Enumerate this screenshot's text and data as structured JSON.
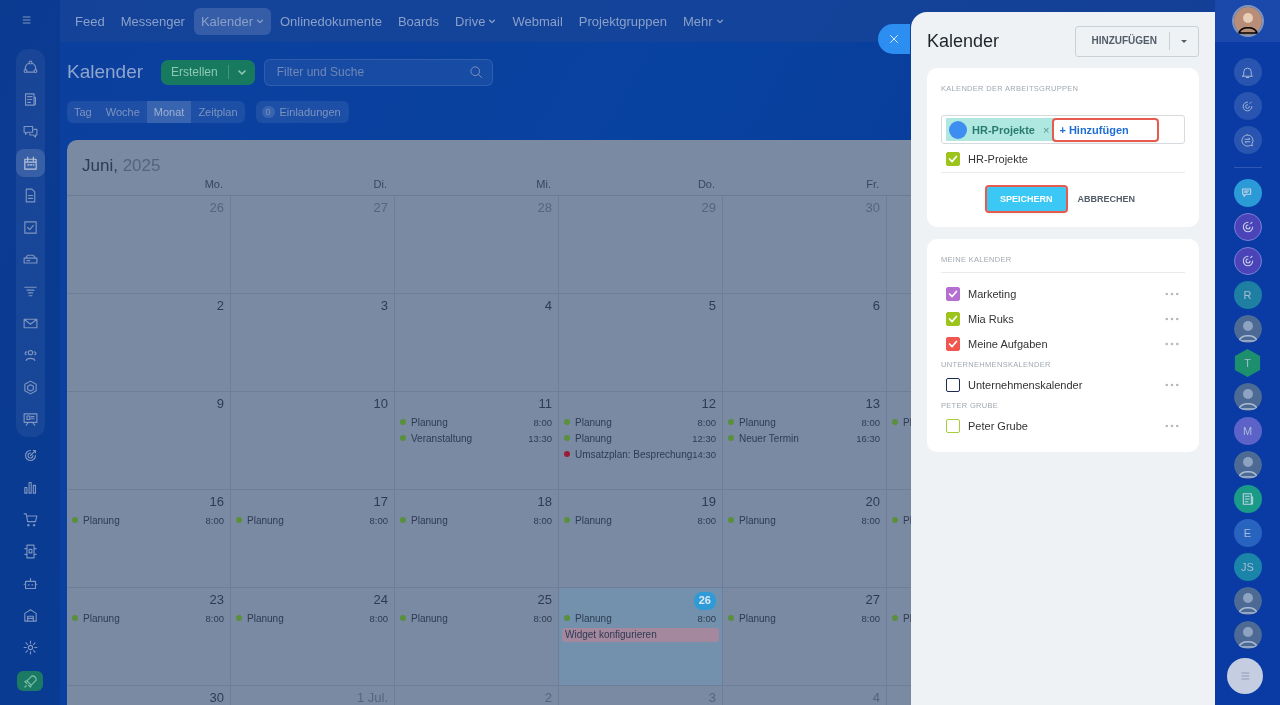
{
  "topnav": [
    {
      "label": "Feed",
      "selected": false,
      "dropdown": false
    },
    {
      "label": "Messenger",
      "selected": false,
      "dropdown": false
    },
    {
      "label": "Kalender",
      "selected": true,
      "dropdown": true
    },
    {
      "label": "Onlinedokumente",
      "selected": false,
      "dropdown": false
    },
    {
      "label": "Boards",
      "selected": false,
      "dropdown": false
    },
    {
      "label": "Drive",
      "selected": false,
      "dropdown": true
    },
    {
      "label": "Webmail",
      "selected": false,
      "dropdown": false
    },
    {
      "label": "Projektgruppen",
      "selected": false,
      "dropdown": false
    },
    {
      "label": "Mehr",
      "selected": false,
      "dropdown": true
    }
  ],
  "left_sidebar": {
    "group": [
      {
        "kind": "nodes",
        "selected": false
      },
      {
        "kind": "newspaper",
        "selected": false
      },
      {
        "kind": "chat-bubbles",
        "selected": false
      },
      {
        "kind": "calendar",
        "selected": true
      },
      {
        "kind": "document",
        "selected": false
      },
      {
        "kind": "checkbox",
        "selected": false
      },
      {
        "kind": "drive",
        "selected": false
      },
      {
        "kind": "funnel",
        "selected": false
      },
      {
        "kind": "envelope",
        "selected": false
      },
      {
        "kind": "people",
        "selected": false
      },
      {
        "kind": "hexagon",
        "selected": false
      },
      {
        "kind": "presentation",
        "selected": false
      }
    ],
    "items": [
      {
        "kind": "target",
        "selected": false
      },
      {
        "kind": "bar-chart",
        "selected": false
      },
      {
        "kind": "cart",
        "selected": false
      },
      {
        "kind": "device",
        "selected": false
      },
      {
        "kind": "robot",
        "selected": false
      },
      {
        "kind": "warehouse",
        "selected": false
      },
      {
        "kind": "gear",
        "selected": false
      },
      {
        "kind": "rocket"
      }
    ]
  },
  "page": {
    "title": "Kalender",
    "create_button": "Erstellen",
    "search": {
      "placeholder": "Filter und Suche"
    },
    "view_tabs": [
      {
        "label": "Tag",
        "selected": false
      },
      {
        "label": "Woche",
        "selected": false
      },
      {
        "label": "Monat",
        "selected": true
      },
      {
        "label": "Zeitplan",
        "selected": false
      }
    ],
    "invitations": {
      "count": "0",
      "label": "Einladungen"
    }
  },
  "calendar": {
    "month": "Juni,",
    "year": "2025",
    "weekdays": [
      "Mo.",
      "Di.",
      "Mi.",
      "Do.",
      "Fr."
    ],
    "weeks": [
      [
        {
          "date": "26",
          "muted": true
        },
        {
          "date": "27",
          "muted": true
        },
        {
          "date": "28",
          "muted": true
        },
        {
          "date": "29",
          "muted": true
        },
        {
          "date": "30",
          "muted": true
        }
      ],
      [
        {
          "date": "2",
          "muted": false
        },
        {
          "date": "3",
          "muted": false
        },
        {
          "date": "4",
          "muted": false
        },
        {
          "date": "5",
          "muted": false
        },
        {
          "date": "6",
          "muted": false
        }
      ],
      [
        {
          "date": "9",
          "muted": false
        },
        {
          "date": "10",
          "muted": false
        },
        {
          "date": "11",
          "muted": false,
          "events": [
            {
              "kind": "dot",
              "title": "Planung",
              "time": "8:00",
              "color": "#5a8f3c"
            },
            {
              "kind": "dot",
              "title": "Veranstaltung",
              "time": "13:30",
              "color": "#5a8f3c"
            }
          ]
        },
        {
          "date": "12",
          "muted": false,
          "events": [
            {
              "kind": "dot",
              "title": "Planung",
              "time": "8:00",
              "color": "#5a8f3c"
            },
            {
              "kind": "dot",
              "title": "Planung",
              "time": "12:30",
              "color": "#5a8f3c"
            },
            {
              "kind": "dot",
              "title": "Umsatzplan: Besprechung",
              "time": "14:30",
              "color": "#9b1c3a"
            }
          ]
        },
        {
          "date": "13",
          "muted": false,
          "events": [
            {
              "kind": "dot",
              "title": "Planung",
              "time": "8:00",
              "color": "#5a8f3c"
            },
            {
              "kind": "dot",
              "title": "Neuer Termin",
              "time": "16:30",
              "color": "#5a8f3c"
            }
          ]
        },
        {
          "events": [
            {
              "kind": "dot",
              "title": "Pl",
              "color": "#5a8f3c"
            }
          ]
        }
      ],
      [
        {
          "date": "16",
          "muted": false,
          "events": [
            {
              "kind": "dot",
              "title": "Planung",
              "time": "8:00",
              "color": "#5a8f3c"
            }
          ]
        },
        {
          "date": "17",
          "muted": false,
          "events": [
            {
              "kind": "dot",
              "title": "Planung",
              "time": "8:00",
              "color": "#5a8f3c"
            }
          ]
        },
        {
          "date": "18",
          "muted": false,
          "events": [
            {
              "kind": "dot",
              "title": "Planung",
              "time": "8:00",
              "color": "#5a8f3c"
            }
          ]
        },
        {
          "date": "19",
          "muted": false,
          "events": [
            {
              "kind": "dot",
              "title": "Planung",
              "time": "8:00",
              "color": "#5a8f3c"
            }
          ]
        },
        {
          "date": "20",
          "muted": false,
          "events": [
            {
              "kind": "dot",
              "title": "Planung",
              "time": "8:00",
              "color": "#5a8f3c"
            }
          ]
        },
        {
          "events": [
            {
              "kind": "dot",
              "title": "Pl",
              "color": "#5a8f3c"
            }
          ]
        }
      ],
      [
        {
          "date": "23",
          "muted": false,
          "events": [
            {
              "kind": "dot",
              "title": "Planung",
              "time": "8:00",
              "color": "#5a8f3c"
            }
          ]
        },
        {
          "date": "24",
          "muted": false,
          "events": [
            {
              "kind": "dot",
              "title": "Planung",
              "time": "8:00",
              "color": "#5a8f3c"
            }
          ]
        },
        {
          "date": "25",
          "muted": false,
          "events": [
            {
              "kind": "dot",
              "title": "Planung",
              "time": "8:00",
              "color": "#5a8f3c"
            }
          ]
        },
        {
          "date": "26",
          "muted": false,
          "today": true,
          "events": [
            {
              "kind": "dot",
              "title": "Planung",
              "time": "8:00",
              "color": "#5a8f3c"
            },
            {
              "kind": "bar",
              "title": "Widget konfigurieren",
              "color": "#a3889e"
            }
          ]
        },
        {
          "date": "27",
          "muted": false,
          "events": [
            {
              "kind": "dot",
              "title": "Planung",
              "time": "8:00",
              "color": "#5a8f3c"
            }
          ]
        },
        {
          "events": [
            {
              "kind": "dot",
              "title": "Pl",
              "color": "#5a8f3c"
            }
          ]
        }
      ],
      [
        {
          "date": "30",
          "muted": false
        },
        {
          "date": "1 Jul.",
          "muted": true
        },
        {
          "date": "2",
          "muted": true
        },
        {
          "date": "3",
          "muted": true
        },
        {
          "date": "4",
          "muted": true
        }
      ]
    ]
  },
  "panel": {
    "title": "Kalender",
    "add_button": "HINZUFÜGEN",
    "workgroups": {
      "heading": "KALENDER DER ARBEITSGRUPPEN",
      "tags": [
        {
          "label": "HR-Projekte",
          "remove": "×"
        }
      ],
      "add_link": {
        "label": "+ Hinzufügen",
        "highlighted": true
      },
      "items": [
        {
          "label": "HR-Projekte",
          "checked": true,
          "color": "#9dc41a"
        }
      ],
      "save": {
        "label": "SPEICHERN",
        "highlighted": true
      },
      "cancel": "ABBRECHEN"
    },
    "sections": [
      {
        "heading": "MEINE KALENDER",
        "items": [
          {
            "label": "Marketing",
            "checked": true,
            "color": "#b56fd1"
          },
          {
            "label": "Mia Ruks",
            "checked": true,
            "color": "#9dc41a"
          },
          {
            "label": "Meine Aufgaben",
            "checked": true,
            "color": "#f2574f"
          }
        ]
      },
      {
        "heading": "UNTERNEHMENSKALENDER",
        "items": [
          {
            "label": "Unternehmenskalender",
            "checked": false,
            "color": "#1d2b4f"
          }
        ]
      },
      {
        "heading": "PETER GRUBE",
        "items": [
          {
            "label": "Peter Grube",
            "checked": false,
            "color": "#a6cf3a"
          }
        ]
      }
    ]
  },
  "right_sidebar": {
    "chats": [
      {
        "kind": "chat-bubble"
      },
      {
        "kind": "copilot"
      },
      {
        "kind": "copilot"
      },
      {
        "kind": "letter",
        "text": "R",
        "color": "#1e7fa2"
      },
      {
        "kind": "photo"
      },
      {
        "kind": "hex-letter",
        "text": "T",
        "color": "#1c8f6f"
      },
      {
        "kind": "photo"
      },
      {
        "kind": "letter",
        "text": "M",
        "color": "#5d62c8"
      },
      {
        "kind": "photo"
      },
      {
        "kind": "document"
      },
      {
        "kind": "letter",
        "text": "E",
        "color": "#2863c0"
      },
      {
        "kind": "letter",
        "text": "JS",
        "color": "#1a85a8"
      },
      {
        "kind": "photo"
      },
      {
        "kind": "photo"
      }
    ]
  }
}
